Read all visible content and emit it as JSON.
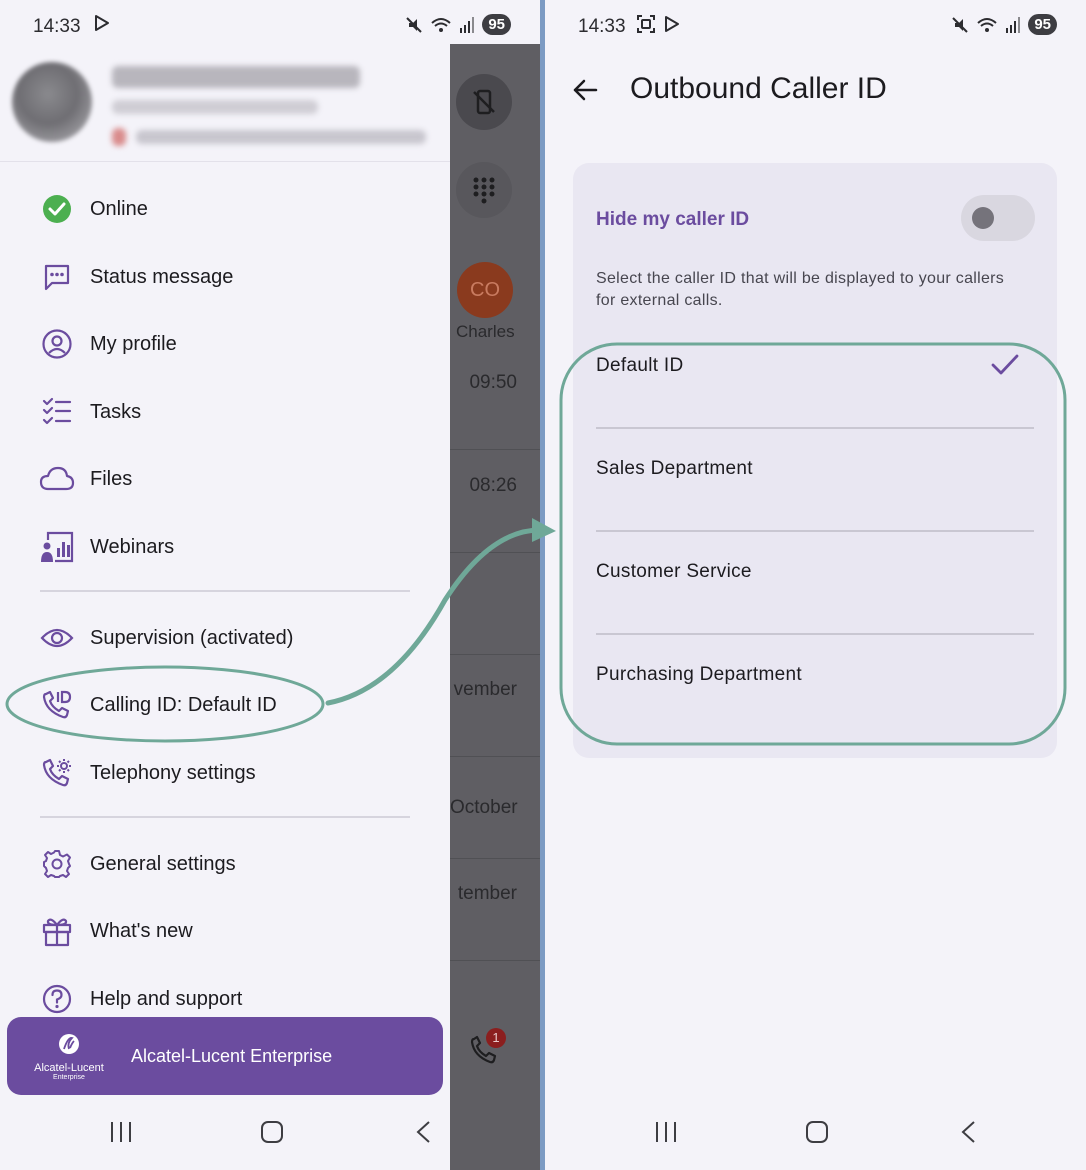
{
  "left": {
    "status_bar": {
      "time": "14:33",
      "battery": "95"
    },
    "header": {
      "name_blurred": "",
      "org_blurred": ""
    },
    "menu": [
      {
        "id": "online",
        "label": "Online",
        "icon": "online-check-icon"
      },
      {
        "id": "status-message",
        "label": "Status message",
        "icon": "message-icon"
      },
      {
        "id": "my-profile",
        "label": "My profile",
        "icon": "profile-icon"
      },
      {
        "id": "tasks",
        "label": "Tasks",
        "icon": "tasks-icon"
      },
      {
        "id": "files",
        "label": "Files",
        "icon": "cloud-icon"
      },
      {
        "id": "webinars",
        "label": "Webinars",
        "icon": "webinar-icon"
      },
      {
        "id": "supervision",
        "label": "Supervision (activated)",
        "icon": "eye-icon"
      },
      {
        "id": "calling-id",
        "label": "Calling ID: Default ID",
        "icon": "phone-id-icon"
      },
      {
        "id": "telephony-settings",
        "label": "Telephony settings",
        "icon": "phone-settings-icon"
      },
      {
        "id": "general-settings",
        "label": "General settings",
        "icon": "gear-icon"
      },
      {
        "id": "whats-new",
        "label": "What's new",
        "icon": "gift-icon"
      },
      {
        "id": "help-support",
        "label": "Help and support",
        "icon": "help-icon"
      }
    ],
    "brand": {
      "logo_name": "Alcatel-Lucent",
      "logo_sub": "Enterprise",
      "text": "Alcatel-Lucent Enterprise"
    },
    "background_app": {
      "avatar_initials": "CO",
      "contact_name": "Charles",
      "times": [
        "09:50",
        "08:26"
      ],
      "months": [
        "vember",
        "October",
        "tember"
      ],
      "calls_badge": "1"
    }
  },
  "right": {
    "status_bar": {
      "time": "14:33",
      "battery": "95"
    },
    "title": "Outbound Caller ID",
    "hide_caller_id": {
      "label": "Hide my caller ID",
      "enabled": false
    },
    "description": "Select the caller ID that will be displayed to your callers for external calls.",
    "options": [
      {
        "label": "Default ID",
        "selected": true
      },
      {
        "label": "Sales Department",
        "selected": false
      },
      {
        "label": "Customer Service",
        "selected": false
      },
      {
        "label": "Purchasing Department",
        "selected": false
      }
    ]
  },
  "colors": {
    "accent": "#6b4c9f",
    "annotation": "#6fa898",
    "online": "#4caf50",
    "background_dim": "#5f5e63"
  }
}
